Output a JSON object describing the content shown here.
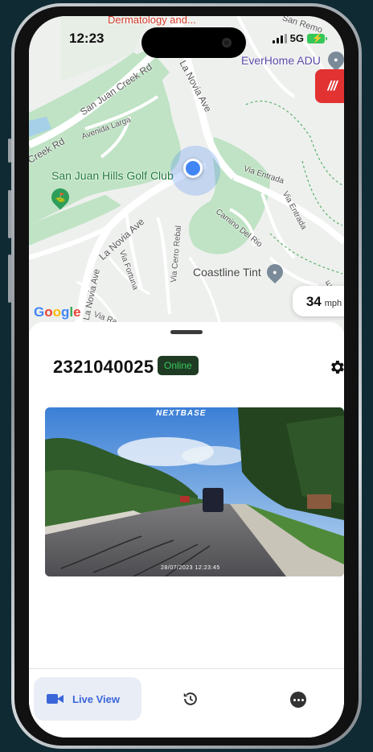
{
  "status_bar": {
    "time": "12:23",
    "network": "5G"
  },
  "map": {
    "labels": {
      "top_poi": "Dermatology and...",
      "san_remo": "San Remo",
      "everhome": "EverHome ADU",
      "san_juan_creek_rd": "San Juan Creek Rd",
      "la_novia_ave_top": "La Novia Ave",
      "creek_rd": "Creek Rd",
      "avenida_larga": "Avenida Larga",
      "golf_club": "San Juan Hills Golf Club",
      "via_entrada": "Via Entrada",
      "via_entrada_2": "Via Entrada",
      "camino_del_rio": "Camino Del Rio",
      "la_novia_ave_mid": "La Novia Ave",
      "via_fortuna": "Via Fortuna",
      "via_cerro_rebal": "Via Cerro Rebal",
      "la_novia_ave_bottom": "La Novia Ave",
      "via_ra": "Via Ra",
      "coastline_tint": "Coastline Tint",
      "via_e": "Via E"
    },
    "brand_badge": "///",
    "google_logo": "Google",
    "speed": {
      "value": "34",
      "unit": "mph"
    }
  },
  "device": {
    "id": "2321040025",
    "status": "Online"
  },
  "video": {
    "brand": "NEXTBASE",
    "timestamp": "28/07/2023  12:23:45"
  },
  "tabs": {
    "live_view": "Live View"
  },
  "colors": {
    "accent": "#3a66d9",
    "online_text": "#36c95c",
    "online_bg": "#1f3b24",
    "brand_red": "#e23232"
  }
}
